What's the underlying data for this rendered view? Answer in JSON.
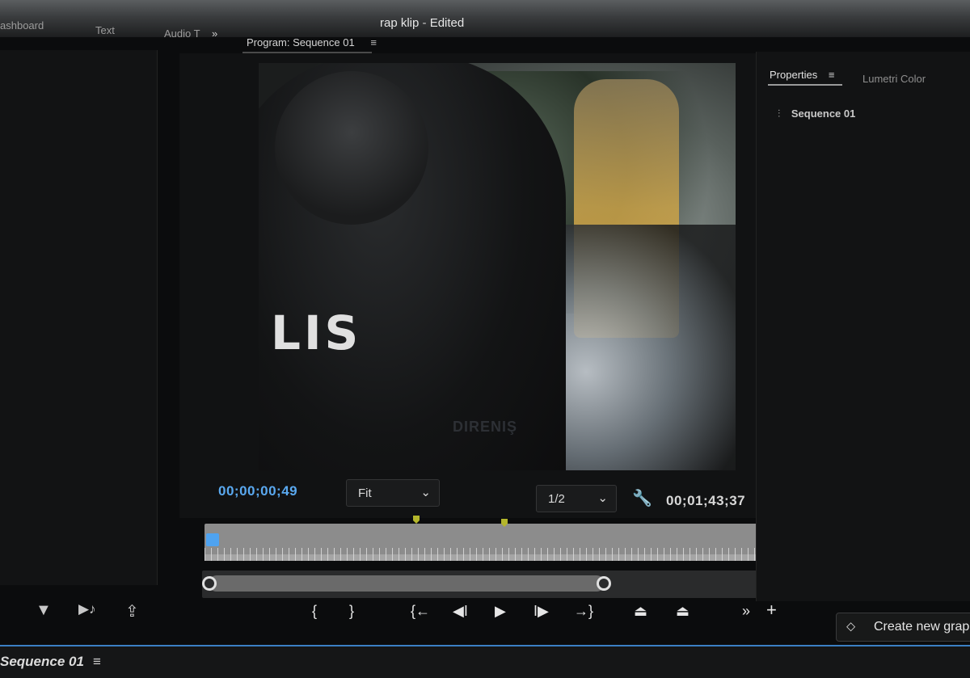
{
  "window": {
    "title": "rap klip",
    "status": "Edited",
    "separator": "-"
  },
  "tabs_left": [
    {
      "label": "ashboard"
    },
    {
      "label": "Text"
    },
    {
      "label": "Audio T"
    }
  ],
  "tabs_overflow": "»",
  "program_monitor": {
    "tab_label": "Program: Sequence 01",
    "menu_icon": "≡",
    "frame": {
      "overlay_text": "LIS",
      "watermark": "DIRENIŞ"
    },
    "current_timecode": "00;00;00;49",
    "fit_select": {
      "value": "Fit",
      "chevron": "⌄"
    },
    "resolution_select": {
      "value": "1/2",
      "chevron": "⌄"
    },
    "duration_timecode": "00;01;43;37",
    "settings_icon": "🔧",
    "playhead_position": 0.0
  },
  "transport": [
    {
      "name": "mark-in",
      "glyph": "{"
    },
    {
      "name": "mark-out",
      "glyph": "}"
    },
    {
      "name": "go-to-in",
      "glyph": "{←"
    },
    {
      "name": "step-back",
      "glyph": "◀I"
    },
    {
      "name": "play",
      "glyph": "▶"
    },
    {
      "name": "step-forward",
      "glyph": "I▶"
    },
    {
      "name": "go-to-out",
      "glyph": "→}"
    },
    {
      "name": "lift",
      "glyph": "⏏"
    },
    {
      "name": "extract",
      "glyph": "⏏"
    },
    {
      "name": "more",
      "glyph": "»"
    },
    {
      "name": "add",
      "glyph": "+"
    }
  ],
  "left_panel_tools": [
    {
      "name": "filter",
      "glyph": "▼"
    },
    {
      "name": "audio",
      "glyph": "▶♪"
    },
    {
      "name": "export",
      "glyph": "⇪"
    }
  ],
  "properties": {
    "tab_active": "Properties",
    "menu_icon": "≡",
    "tab_inactive": "Lumetri Color",
    "sequence_label": "Sequence 01",
    "sequence_icon": "⫶"
  },
  "create_button": {
    "label": "Create new grap",
    "icon": "⬦"
  },
  "timeline": {
    "sequence_label": "Sequence 01",
    "menu_icon": "≡"
  },
  "colors": {
    "accent_blue": "#4fa3f0",
    "marker_yellow": "#b4b62c"
  }
}
